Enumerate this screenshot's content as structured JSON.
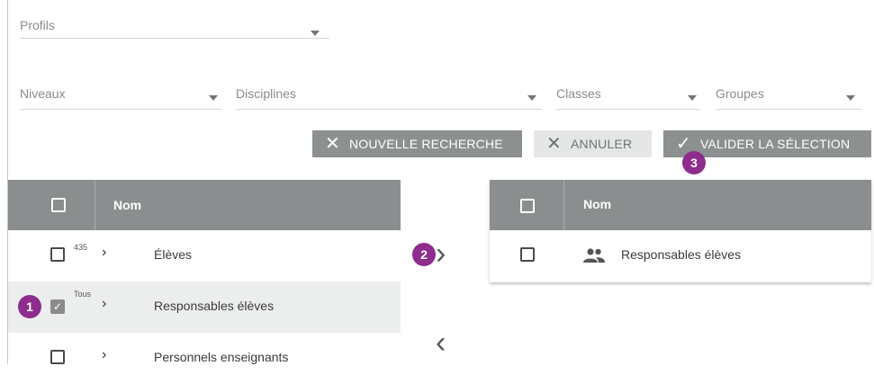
{
  "filters": {
    "profils": "Profils",
    "niveaux": "Niveaux",
    "disciplines": "Disciplines",
    "classes": "Classes",
    "groupes": "Groupes"
  },
  "buttons": {
    "new_search": "NOUVELLE RECHERCHE",
    "cancel": "ANNULER",
    "validate": "VALIDER LA SÉLECTION"
  },
  "badges": [
    "1",
    "2",
    "3"
  ],
  "left_table": {
    "header": "Nom",
    "rows": [
      {
        "count": "435",
        "label": "Élèves",
        "checked": false
      },
      {
        "count": "Tous",
        "label": "Responsables élèves",
        "checked": true
      },
      {
        "count": "",
        "label": "Personnels enseignants",
        "checked": false
      }
    ]
  },
  "right_table": {
    "header": "Nom",
    "rows": [
      {
        "label": "Responsables élèves",
        "icon": "group-icon"
      }
    ]
  },
  "colors": {
    "header_bg": "#8a8e8e",
    "badge": "#8e2d8e",
    "highlight_row": "#eceeee"
  }
}
